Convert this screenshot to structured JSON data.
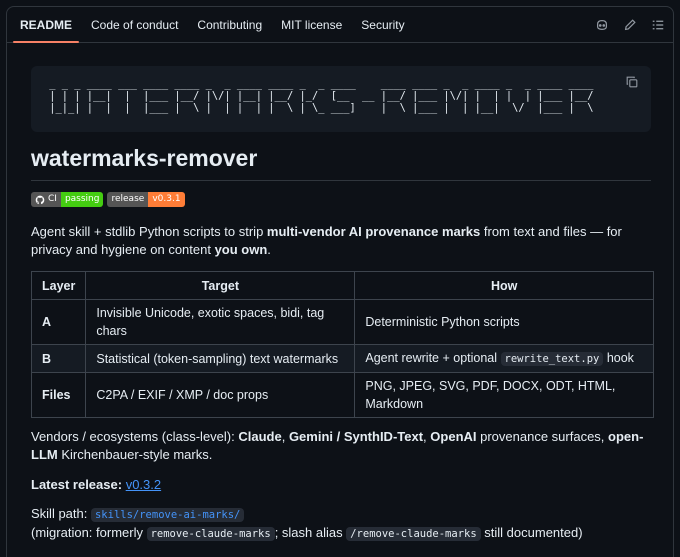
{
  "tabs": [
    {
      "label": "README",
      "active": true
    },
    {
      "label": "Code of conduct"
    },
    {
      "label": "Contributing"
    },
    {
      "label": "MIT license"
    },
    {
      "label": "Security"
    }
  ],
  "toolbar_icons": [
    "copilot-icon",
    "pencil-icon",
    "outline-list-icon"
  ],
  "ascii_banner": " _ _ _ ____ ___ ____ ____ _  _ ____ ____ _  _ ____    ____ ____ _  _ ____ _  _ ____ ____\n | | | |__|  |  |___ |__/ |\\/| |__| |__/ |_/  [__  __ |__/ |___ |\\/| |  | |  | |___ |__/\n |_|_| |  |  |  |___ |  \\ |  | |  | |  \\ | \\_ ___]    |  \\ |___ |  | |__|  \\/  |___ |  \\",
  "title": "watermarks-remover",
  "badges": {
    "ci_label": "CI",
    "ci_status": "passing",
    "ci_color": "#4c1",
    "release_label": "release",
    "release_version": "v0.3.1",
    "release_color": "#fe7d37"
  },
  "desc": {
    "p1": "Agent skill + stdlib Python scripts to strip ",
    "b1": "multi-vendor AI provenance marks",
    "p2": " from text and files — for privacy and hygiene on content ",
    "b2": "you own",
    "p3": "."
  },
  "table": {
    "headers": [
      "Layer",
      "Target",
      "How"
    ],
    "rows": [
      {
        "layer": "A",
        "target": "Invisible Unicode, exotic spaces, bidi, tag chars",
        "how": "Deterministic Python scripts"
      },
      {
        "layer": "B",
        "target": "Statistical (token-sampling) text watermarks",
        "how_pre": "Agent rewrite + optional ",
        "how_code": "rewrite_text.py",
        "how_post": " hook"
      },
      {
        "layer": "Files",
        "target": "C2PA / EXIF / XMP / doc props",
        "how": "PNG, JPEG, SVG, PDF, DOCX, ODT, HTML, Markdown"
      }
    ]
  },
  "vendors": {
    "p1": "Vendors / ecosystems (class-level): ",
    "b1": "Claude",
    "p2": ", ",
    "b2": "Gemini / SynthID-Text",
    "p3": ", ",
    "b3": "OpenAI",
    "p4": " provenance surfaces, ",
    "b4": "open-LLM",
    "p5": " Kirchenbauer-style marks."
  },
  "latest": {
    "label": "Latest release:",
    "version": "v0.3.2"
  },
  "skill": {
    "label": "Skill path: ",
    "path": "skills/remove-ai-marks/",
    "mig_pre": "(migration: formerly ",
    "old_name": "remove-claude-marks",
    "mig_mid": "; slash alias ",
    "alias": "/remove-claude-marks",
    "mig_post": " still documented)"
  },
  "colors": {
    "accent": "#f78166",
    "link": "#4493f8",
    "bg": "#0d1117"
  }
}
